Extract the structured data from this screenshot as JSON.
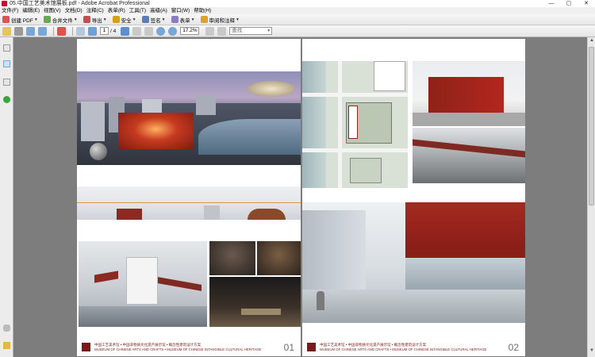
{
  "window": {
    "title": "05.中国工艺美术馆展板.pdf - Adobe Acrobat Professional"
  },
  "window_controls": {
    "minimize": "—",
    "maximize": "▢",
    "close": "✕"
  },
  "menu": [
    "文件(F)",
    "编辑(E)",
    "视图(V)",
    "文档(D)",
    "注释(C)",
    "表单(R)",
    "工具(T)",
    "高级(A)",
    "窗口(W)",
    "帮助(H)"
  ],
  "toolbar1": {
    "create_pdf": "创建 PDF",
    "combine": "合并文件",
    "export": "导出",
    "secure": "安全",
    "sign": "签名",
    "forms": "表单",
    "review": "审阅和注释"
  },
  "toolbar2": {
    "page_current": "1",
    "page_total": "/ 4",
    "zoom": "17.2%",
    "search_placeholder": "查找"
  },
  "pages": [
    {
      "caption_cn": "中国工艺美术馆 • 中国非物质文化遗产展示馆 • 概念性建筑设计方案",
      "caption_en": "MUSEUM OF CHINESE ARTS AND CRAFTS • MUSEUM OF CHINESE INTANGIBLE CULTURAL HERITAGE",
      "page_number": "01"
    },
    {
      "caption_cn": "中国工艺美术馆 • 中国非物质文化遗产展示馆 • 概念性建筑设计方案",
      "caption_en": "MUSEUM OF CHINESE ARTS AND CRAFTS • MUSEUM OF CHINESE INTANGIBLE CULTURAL HERITAGE",
      "page_number": "02"
    }
  ],
  "colors": {
    "accent_red": "#b3261e",
    "caption_red": "#7a1a1a",
    "doc_bg": "#7d7d7d"
  }
}
